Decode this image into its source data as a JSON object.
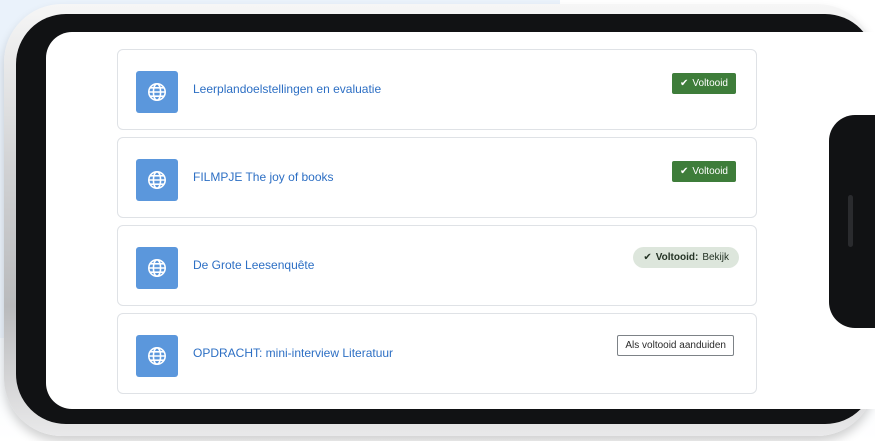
{
  "activities": [
    {
      "title": "Leerplandoelstellingen en evaluatie",
      "status_type": "done",
      "status_label": "Voltooid",
      "icon": "globe-icon"
    },
    {
      "title": "FILMPJE The joy of books",
      "status_type": "done",
      "status_label": "Voltooid",
      "icon": "globe-icon"
    },
    {
      "title": "De Grote Leesenquête",
      "status_type": "viewed",
      "status_label": "Voltooid:",
      "status_detail": "Bekijk",
      "icon": "globe-icon"
    },
    {
      "title": "OPDRACHT: mini-interview Literatuur",
      "status_type": "manual",
      "status_label": "Als voltooid aanduiden",
      "icon": "globe-icon"
    }
  ],
  "colors": {
    "link": "#2d6fc4",
    "icon_tile": "#5b97dc",
    "done_badge": "#3e7d3a",
    "viewed_pill": "#dde6dc",
    "phone_body": "#111214",
    "backdrop": "#eaf2fb"
  },
  "icons": {
    "check": "check-icon",
    "activity": "globe-icon"
  }
}
